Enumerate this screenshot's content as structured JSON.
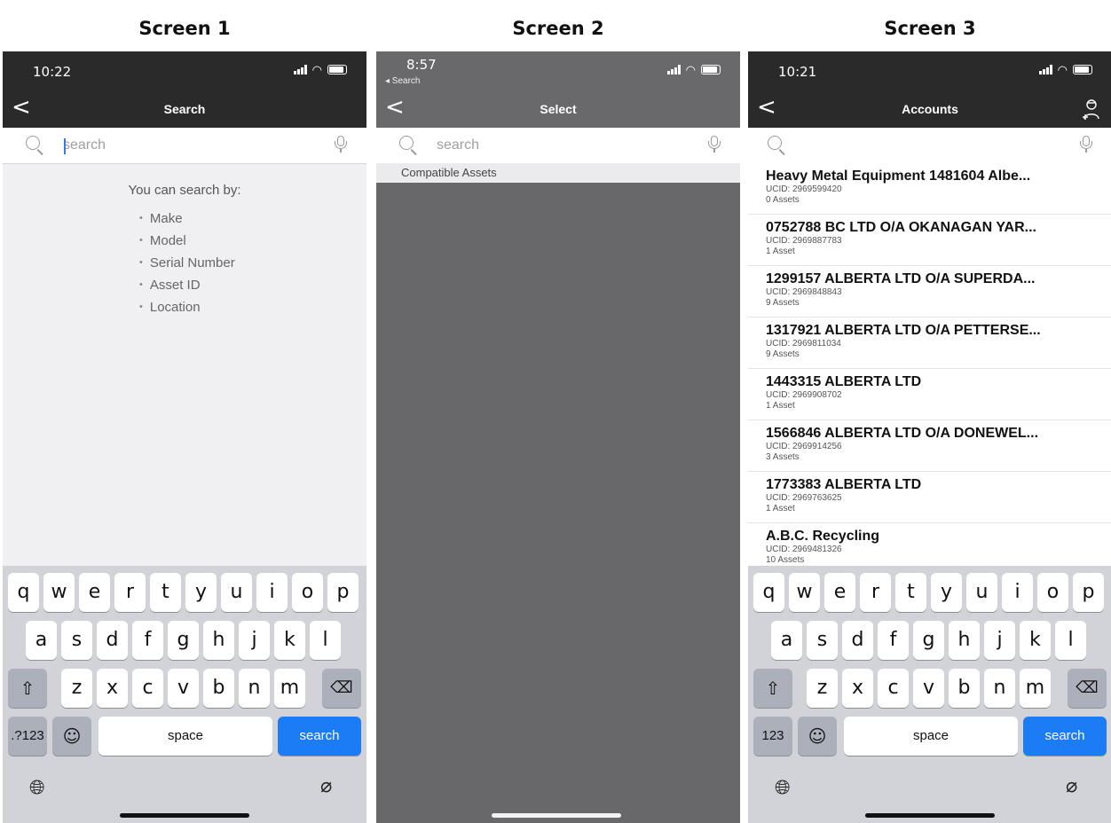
{
  "screens": [
    {
      "title": "Screen 1",
      "status": {
        "time": "10:22"
      },
      "nav": {
        "back": "<",
        "title": "Search"
      },
      "search": {
        "placeholder": "search"
      },
      "hint": {
        "title": "You can search by:",
        "items": [
          "Make",
          "Model",
          "Serial Number",
          "Asset ID",
          "Location"
        ]
      },
      "keyboard": {
        "numbers_label": ".?123",
        "space_label": "space",
        "return_label": "search"
      }
    },
    {
      "title": "Screen 2",
      "status": {
        "time": "8:57",
        "back_app": "◂ Search"
      },
      "nav": {
        "back": "<",
        "title": "Select"
      },
      "search": {
        "placeholder": "search"
      },
      "section": {
        "label": "Compatible Assets"
      }
    },
    {
      "title": "Screen 3",
      "status": {
        "time": "10:21"
      },
      "nav": {
        "back": "<",
        "title": "Accounts"
      },
      "search": {
        "placeholder": ""
      },
      "accounts": [
        {
          "name": "Heavy Metal Equipment 1481604 Albe...",
          "ucid": "UCID: 2969599420",
          "assets": "0 Assets"
        },
        {
          "name": "0752788 BC LTD O/A OKANAGAN YAR...",
          "ucid": "UCID: 2969887783",
          "assets": "1 Asset"
        },
        {
          "name": "1299157 ALBERTA LTD O/A SUPERDA...",
          "ucid": "UCID: 2969848843",
          "assets": "9 Assets"
        },
        {
          "name": "1317921 ALBERTA LTD O/A PETTERSE...",
          "ucid": "UCID: 2969811034",
          "assets": "9 Assets"
        },
        {
          "name": "1443315 ALBERTA LTD",
          "ucid": "UCID: 2969908702",
          "assets": "1 Asset"
        },
        {
          "name": "1566846 ALBERTA LTD O/A DONEWEL...",
          "ucid": "UCID: 2969914256",
          "assets": "3 Assets"
        },
        {
          "name": "1773383 ALBERTA LTD",
          "ucid": "UCID: 2969763625",
          "assets": "1 Asset"
        },
        {
          "name": "A.B.C. Recycling",
          "ucid": "UCID: 2969481326",
          "assets": "10 Assets"
        }
      ],
      "keyboard": {
        "numbers_label": "123",
        "space_label": "space",
        "return_label": "search"
      }
    }
  ],
  "keyboard_rows": {
    "row1": [
      "q",
      "w",
      "e",
      "r",
      "t",
      "y",
      "u",
      "i",
      "o",
      "p"
    ],
    "row2": [
      "a",
      "s",
      "d",
      "f",
      "g",
      "h",
      "j",
      "k",
      "l"
    ],
    "row3": [
      "z",
      "x",
      "c",
      "v",
      "b",
      "n",
      "m"
    ]
  },
  "icons": {
    "back": "chevron-left-icon",
    "search": "magnifier-icon",
    "mic": "microphone-icon",
    "add_user": "add-user-icon",
    "shift": "shift-icon",
    "delete": "delete-icon",
    "emoji": "emoji-icon",
    "globe": "globe-icon",
    "dictation": "dictation-icon"
  }
}
